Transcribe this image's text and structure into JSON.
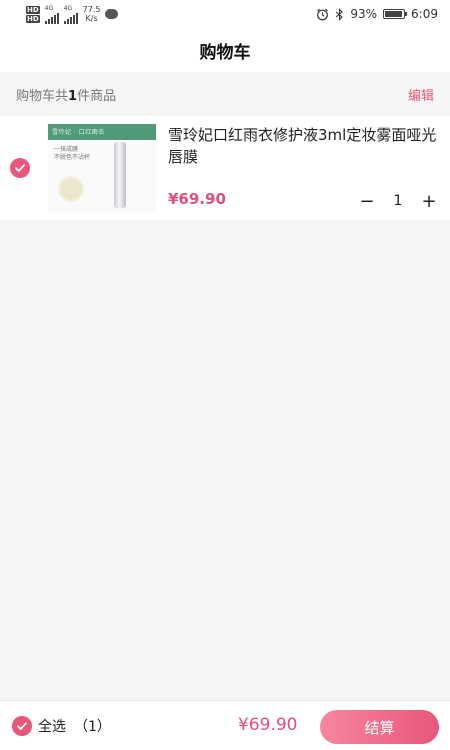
{
  "status_bar": {
    "hd1": "HD",
    "hd2": "HD",
    "net1": "4G",
    "net2": "4G",
    "speed_value": "77.5",
    "speed_unit": "K/s",
    "battery_percent": "93%",
    "battery_level": 0.93,
    "time": "6:09",
    "icons": [
      "alarm-icon",
      "bluetooth-icon",
      "battery-icon",
      "message-icon"
    ]
  },
  "header": {
    "title": "购物车"
  },
  "cart_summary": {
    "prefix": "购物车共",
    "count": "1",
    "suffix": "件商品",
    "edit_label": "编辑"
  },
  "items": [
    {
      "title": "雪玲妃口红雨衣修护液3ml定妆雾面哑光唇膜",
      "price": "¥69.90",
      "quantity": "1",
      "decrease_label": "−",
      "increase_label": "+",
      "checked": true,
      "image_text": {
        "band": "雪玲妃 · 口红雨衣",
        "line1": "一抹成膜",
        "line2": "不脱色不沾杯"
      }
    }
  ],
  "bottom": {
    "select_all_label": "全选",
    "selected_count": "（1）",
    "total": "¥69.90",
    "checkout_label": "结算"
  },
  "colors": {
    "accent": "#e8577a",
    "price": "#e0507a",
    "background": "#f5f5f5"
  }
}
